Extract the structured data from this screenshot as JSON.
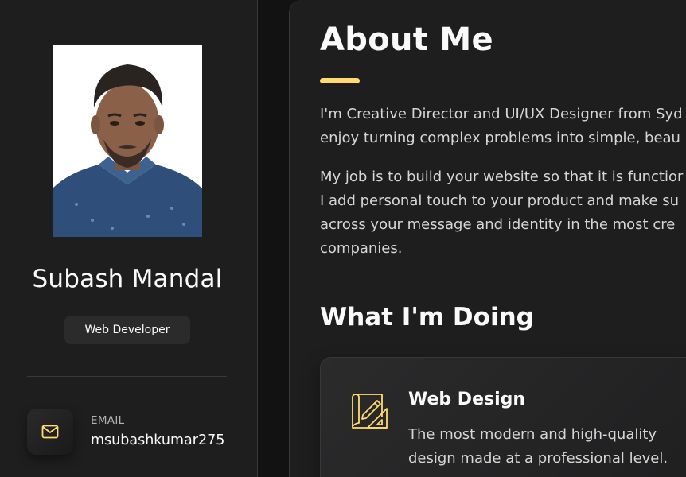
{
  "profile": {
    "name": "Subash Mandal",
    "title": "Web Developer"
  },
  "contact": {
    "label": "EMAIL",
    "value": "msubashkumar275",
    "icon": "mail-icon"
  },
  "about": {
    "heading": "About Me",
    "paragraph1_lines": [
      "I'm Creative Director and UI/UX Designer from Syd",
      "enjoy turning complex problems into simple, beau"
    ],
    "paragraph2_lines": [
      "My job is to build your website so that it is functior",
      "I add personal touch to your product and make su",
      "across your message and identity in the most cre",
      "companies."
    ]
  },
  "services": {
    "heading": "What I'm Doing",
    "items": [
      {
        "title": "Web Design",
        "description_lines": [
          "The most modern and high-quality",
          "design made at a professional level."
        ],
        "icon": "design-icon"
      }
    ]
  },
  "colors": {
    "accent": "#ffdb70",
    "background": "#1e1e1f",
    "text": "#fafafa",
    "muted_text": "#d6d6d6"
  }
}
